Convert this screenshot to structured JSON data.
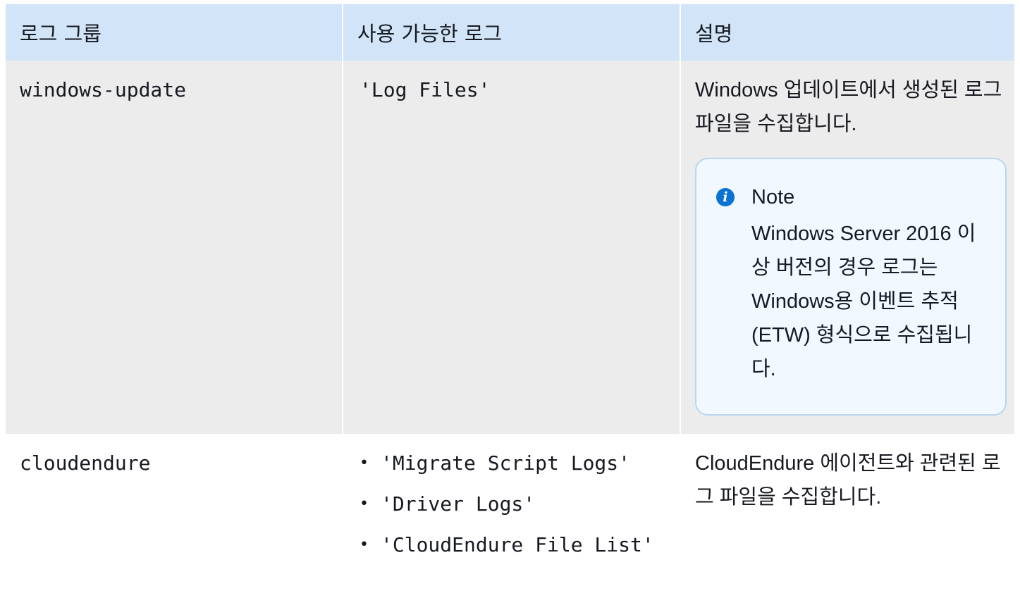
{
  "table": {
    "headers": {
      "log_group": "로그 그룹",
      "available_logs": "사용 가능한 로그",
      "description": "설명"
    },
    "rows": [
      {
        "log_group": "windows-update",
        "available_logs": "'Log Files'",
        "description": "Windows 업데이트에서 생성된 로그 파일을 수집합니다.",
        "note": {
          "icon": "info-icon",
          "title": "Note",
          "body": "Windows Server 2016 이상 버전의 경우 로그는 Windows용 이벤트 추적(ETW) 형식으로 수집됩니다."
        }
      },
      {
        "log_group": "cloudendure",
        "available_logs_list": [
          "'Migrate Script Logs'",
          "'Driver Logs'",
          "'CloudEndure File List'"
        ],
        "description": "CloudEndure 에이전트와 관련된 로그 파일을 수집합니다."
      }
    ]
  },
  "colors": {
    "header_bg": "#d1e4f8",
    "row_alt_bg": "#ececed",
    "note_bg": "#f1f8ff",
    "note_border": "#b8d5f2",
    "info_icon": "#0972d3",
    "text": "#16191f"
  }
}
